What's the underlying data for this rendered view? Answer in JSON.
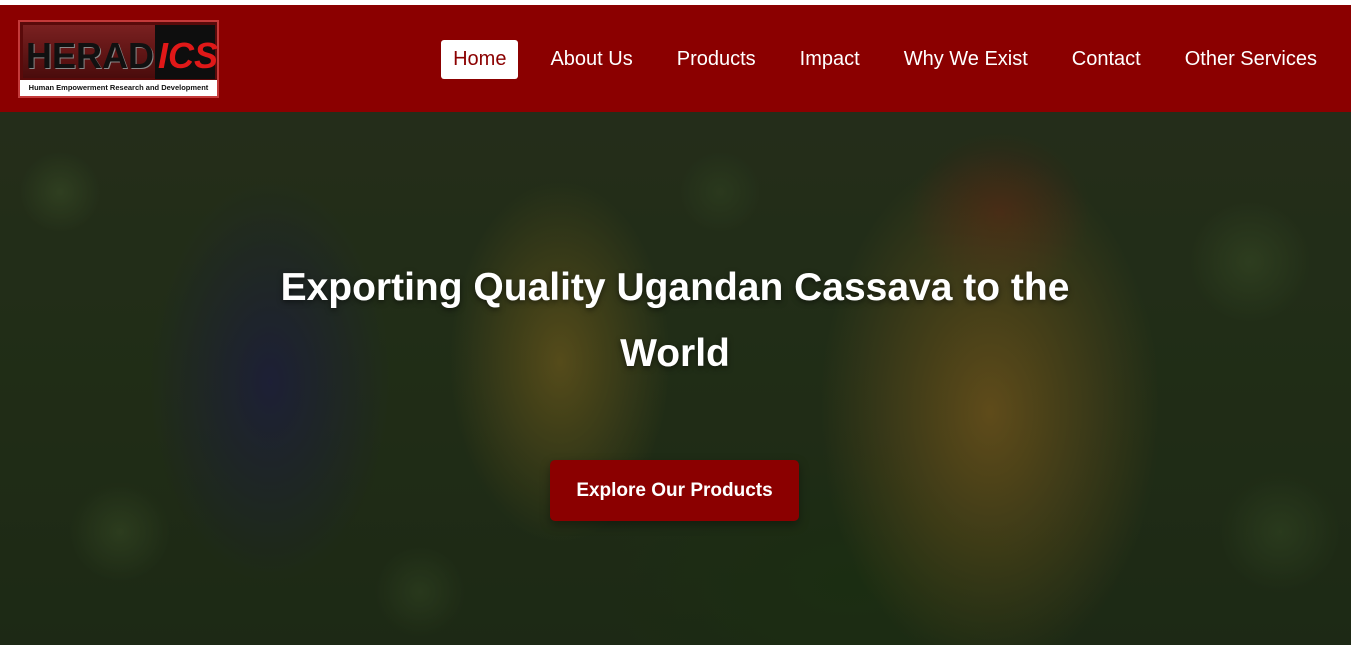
{
  "logo": {
    "brand_main": "HERAD",
    "brand_accent": "ICS",
    "tagline": "Human Empowerment Research and Development"
  },
  "nav": {
    "items": [
      {
        "label": "Home",
        "active": true
      },
      {
        "label": "About Us"
      },
      {
        "label": "Products"
      },
      {
        "label": "Impact"
      },
      {
        "label": "Why We Exist"
      },
      {
        "label": "Contact"
      },
      {
        "label": "Other Services"
      }
    ]
  },
  "hero": {
    "title": "Exporting Quality Ugandan Cassava to the World",
    "cta_label": "Explore Our Products"
  },
  "colors": {
    "brand": "#8b0000",
    "text_light": "#ffffff"
  }
}
